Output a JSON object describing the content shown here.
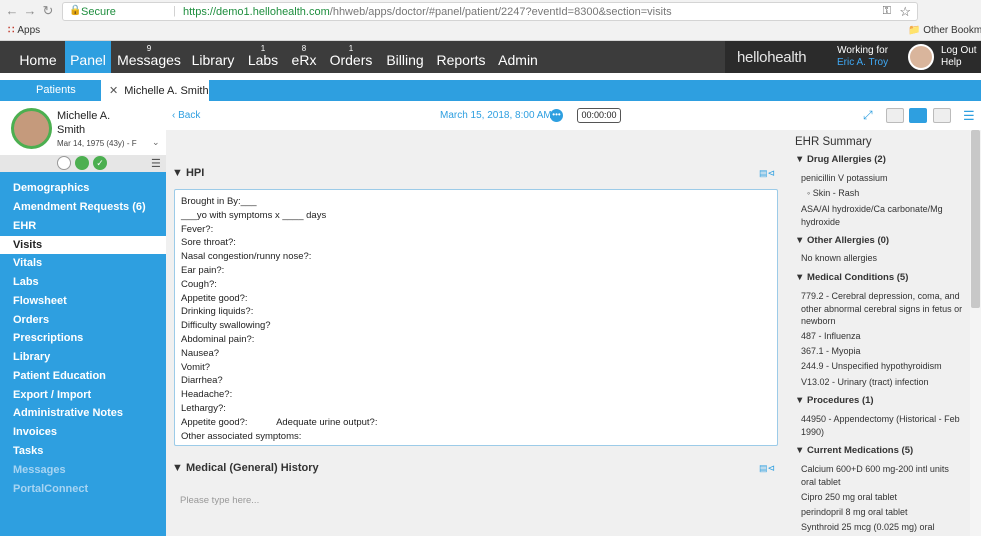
{
  "browser": {
    "secure_label": "Secure",
    "url_host": "https://demo1.hellohealth.com",
    "url_path": "/hhweb/apps/doctor/#panel/patient/2247?eventId=8300&section=visits",
    "apps_label": "Apps",
    "bookmarks_label": "Other Bookma"
  },
  "topnav": {
    "items": [
      {
        "label": "Home",
        "count": ""
      },
      {
        "label": "Panel",
        "count": ""
      },
      {
        "label": "Messages",
        "count": "9"
      },
      {
        "label": "Library",
        "count": ""
      },
      {
        "label": "Labs",
        "count": "1"
      },
      {
        "label": "eRx",
        "count": "8"
      },
      {
        "label": "Orders",
        "count": "1"
      },
      {
        "label": "Billing",
        "count": ""
      },
      {
        "label": "Reports",
        "count": ""
      },
      {
        "label": "Admin",
        "count": ""
      }
    ],
    "brand": "hellohealth",
    "working_for_label": "Working for",
    "working_for_name": "Eric A. Troy",
    "logout": "Log Out",
    "help": "Help"
  },
  "tabs": {
    "patients": "Patients",
    "current": "Michelle A. Smith"
  },
  "patient": {
    "first": "Michelle A.",
    "last": "Smith",
    "dob": "Mar 14, 1975 (43y) - F"
  },
  "sidebar": {
    "items": [
      "Demographics",
      "Amendment Requests (6)",
      "EHR",
      "Visits",
      "Vitals",
      "Labs",
      "Flowsheet",
      "Orders",
      "Prescriptions",
      "Library",
      "Patient Education",
      "Export / Import",
      "Administrative Notes",
      "Invoices",
      "Tasks",
      "Messages",
      "PortalConnect"
    ]
  },
  "toolbar": {
    "back": "Back",
    "visit_date": "March 15, 2018, 8:00 AM",
    "timer": "00:00:00"
  },
  "hpi": {
    "title": "HPI",
    "lines": [
      "Brought in By:___",
      "___yo with symptoms x ____ days",
      "Fever?:",
      "Sore throat?:",
      "Nasal congestion/runny nose?:",
      "Ear pain?:",
      "Cough?:",
      "Appetite good?:",
      "Drinking liquids?:",
      "Difficulty swallowing?",
      "Abdominal pain?:",
      "Nausea?",
      "Vomit?",
      "Diarrhea?",
      "Headache?:",
      "Lethargy?:",
      "Appetite good?:           Adequate urine output?:",
      "Other associated symptoms:"
    ]
  },
  "medical_history": {
    "title": "Medical (General) History",
    "placeholder": "Please type here..."
  },
  "ehr": {
    "title": "EHR Summary",
    "drug_allergies": "Drug Allergies (2)",
    "allergy1": "penicillin V potassium",
    "allergy1_reaction": "Skin - Rash",
    "allergy2": "ASA/Al hydroxide/Ca carbonate/Mg hydroxide",
    "other_allergies": "Other Allergies (0)",
    "no_allergies": "No known allergies",
    "conditions": "Medical Conditions (5)",
    "cond1": "779.2 - Cerebral depression, coma, and other abnormal cerebral signs in fetus or newborn",
    "cond2": "487 - Influenza",
    "cond3": "367.1 - Myopia",
    "cond4": "244.9 - Unspecified hypothyroidism",
    "cond5": "V13.02 - Urinary (tract) infection",
    "procedures": "Procedures (1)",
    "proc1": "44950 - Appendectomy (Historical - Feb 1990)",
    "medications": "Current Medications (5)",
    "med1": "Calcium 600+D 600 mg-200 intl units oral tablet",
    "med2": "Cipro 250 mg oral tablet",
    "med3": "perindopril 8 mg oral tablet",
    "med4": "Synthroid 25 mcg (0.025 mg) oral"
  },
  "colors": {
    "accent": "#2e9fe0",
    "nav_dark": "#3c3c3c"
  }
}
